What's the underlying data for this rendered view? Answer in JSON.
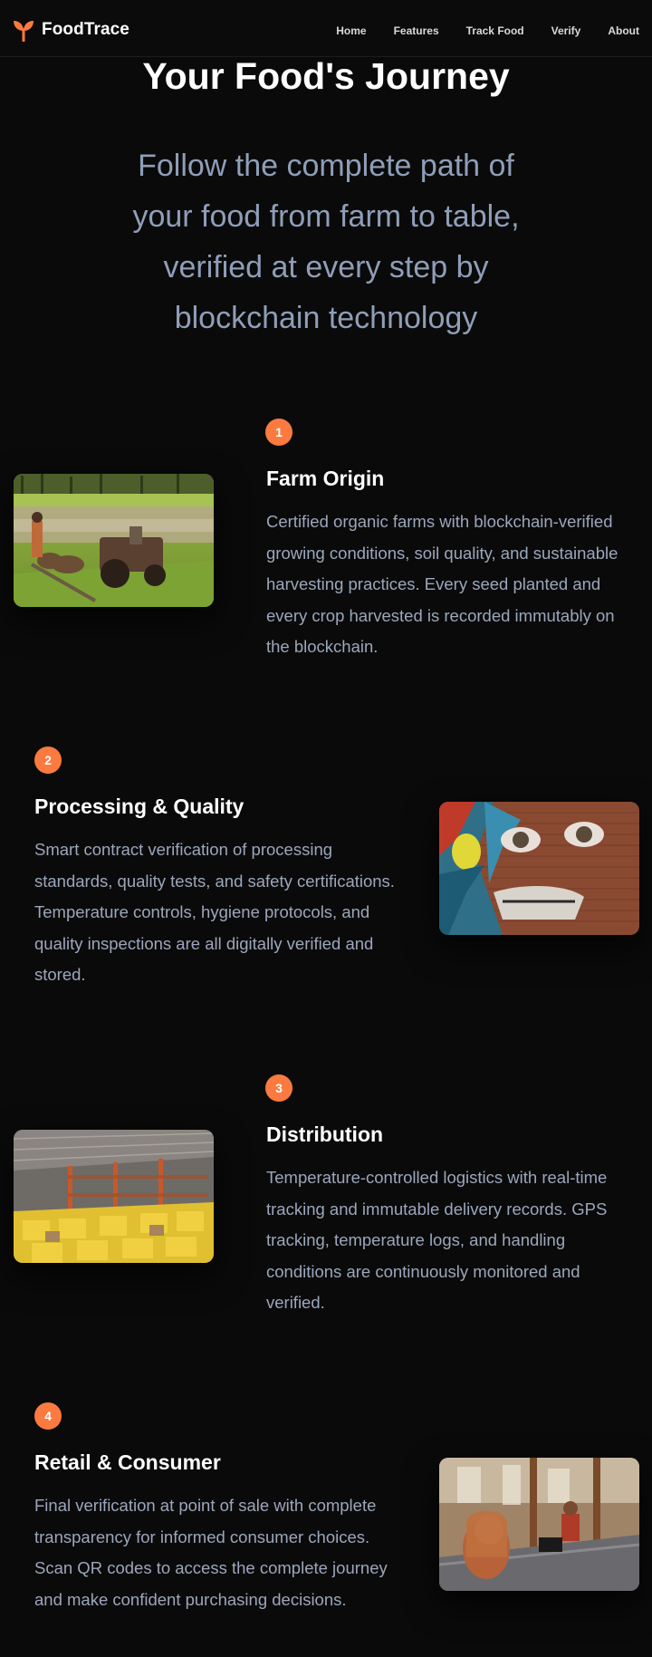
{
  "brand": {
    "name": "FoodTrace",
    "icon": "sprout-icon",
    "accent": "#fb7a40"
  },
  "nav": {
    "items": [
      {
        "label": "Home"
      },
      {
        "label": "Features"
      },
      {
        "label": "Track Food"
      },
      {
        "label": "Verify"
      },
      {
        "label": "About"
      }
    ]
  },
  "hero": {
    "title": "Your Food's Journey",
    "subtitle": "Follow the complete path of your food from farm to table, verified at every step by blockchain technology"
  },
  "steps": [
    {
      "number": "1",
      "title": "Farm Origin",
      "description": "Certified organic farms with blockchain-verified growing conditions, soil quality, and sustainable harvesting practices. Every seed planted and every crop harvested is recorded immutably on the blockchain.",
      "image": "farm-field-photo"
    },
    {
      "number": "2",
      "title": "Processing & Quality",
      "description": "Smart contract verification of processing standards, quality tests, and safety certifications. Temperature controls, hygiene protocols, and quality inspections are all digitally verified and stored.",
      "image": "graffiti-mural-photo"
    },
    {
      "number": "3",
      "title": "Distribution",
      "description": "Temperature-controlled logistics with real-time tracking and immutable delivery records. GPS tracking, temperature logs, and handling conditions are continuously monitored and verified.",
      "image": "warehouse-photo"
    },
    {
      "number": "4",
      "title": "Retail & Consumer",
      "description": "Final verification at point of sale with complete transparency for informed consumer choices. Scan QR codes to access the complete journey and make confident purchasing decisions.",
      "image": "retail-counter-photo"
    }
  ]
}
